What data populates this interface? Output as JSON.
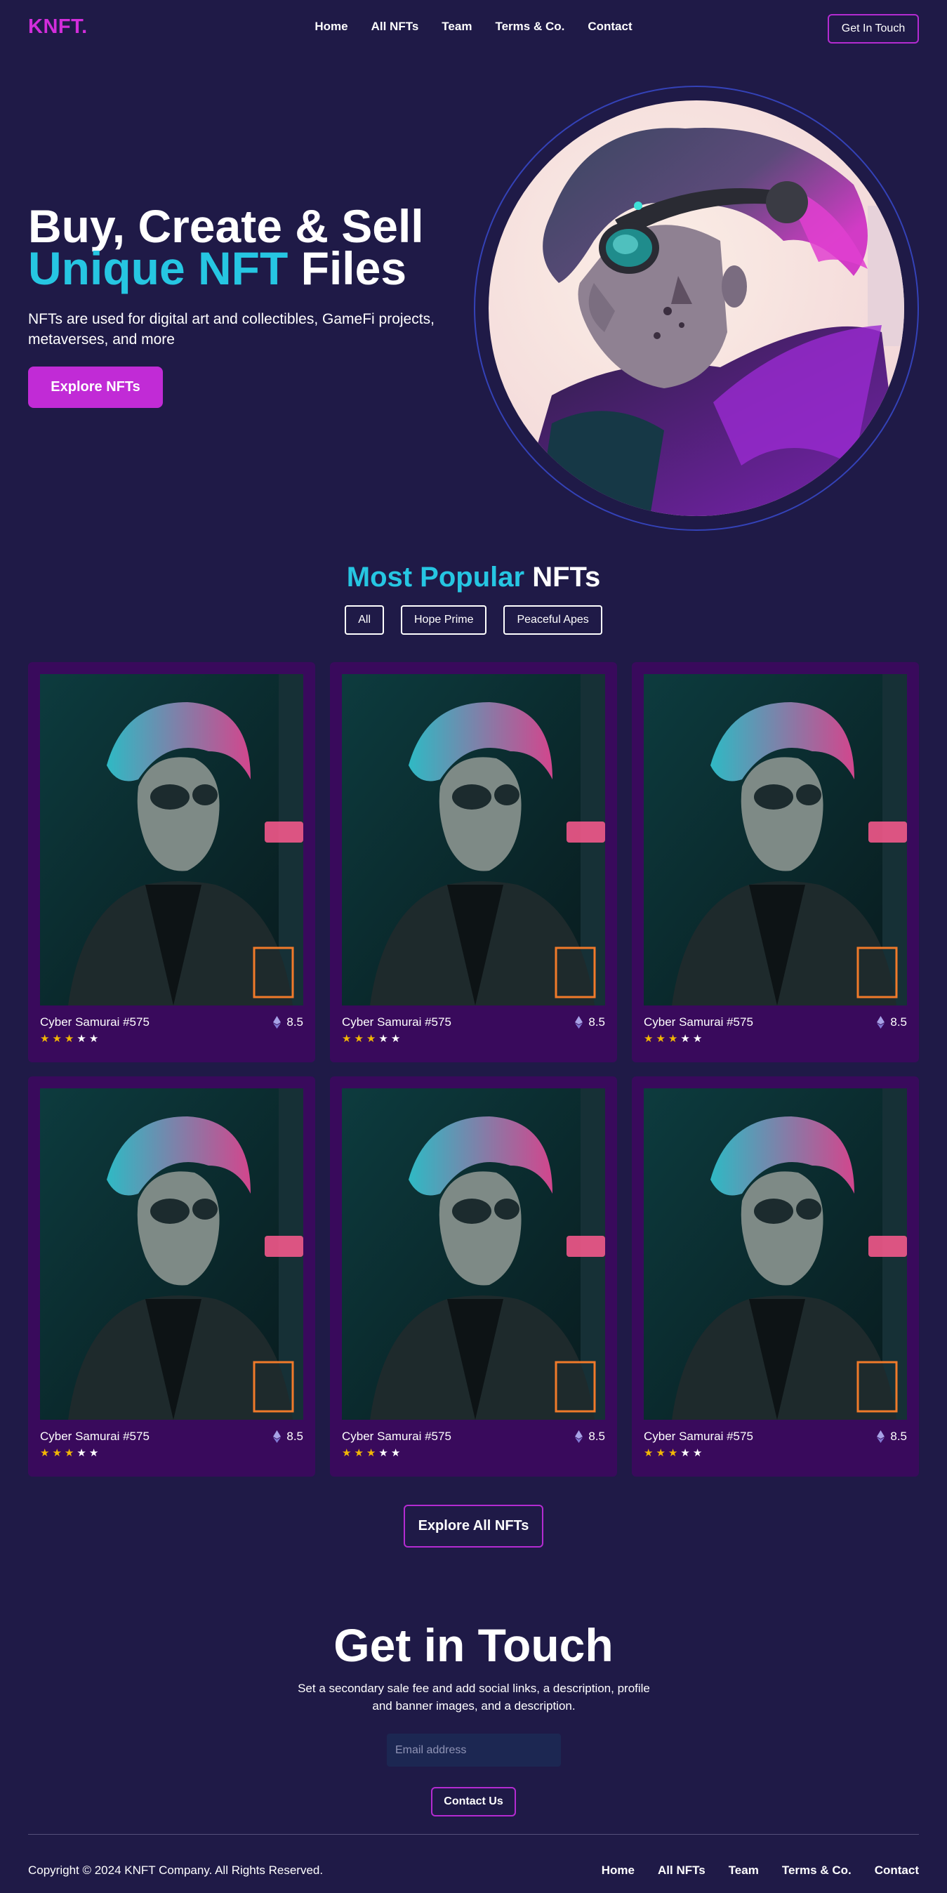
{
  "brand": {
    "logo": "KNFT.",
    "accent": "#d22ddb",
    "highlight": "#26c6e2",
    "background": "#1f1a47"
  },
  "nav": {
    "links": [
      "Home",
      "All NFTs",
      "Team",
      "Terms & Co.",
      "Contact"
    ],
    "cta": "Get In Touch"
  },
  "hero": {
    "title_line1": "Buy, Create & Sell",
    "title_accent": "Unique NFT",
    "title_rest": " Files",
    "subtitle": "NFTs are used for digital art and collectibles, GameFi projects, metaverses, and more",
    "cta": "Explore NFTs"
  },
  "popular": {
    "title_accent": "Most Popular",
    "title_rest": " NFTs",
    "filters": [
      "All",
      "Hope Prime",
      "Peaceful Apes"
    ],
    "cards": [
      {
        "name": "Cyber Samurai #575",
        "price": "8.5",
        "rating": 3,
        "max_rating": 5
      },
      {
        "name": "Cyber Samurai #575",
        "price": "8.5",
        "rating": 3,
        "max_rating": 5
      },
      {
        "name": "Cyber Samurai #575",
        "price": "8.5",
        "rating": 3,
        "max_rating": 5
      },
      {
        "name": "Cyber Samurai #575",
        "price": "8.5",
        "rating": 3,
        "max_rating": 5
      },
      {
        "name": "Cyber Samurai #575",
        "price": "8.5",
        "rating": 3,
        "max_rating": 5
      },
      {
        "name": "Cyber Samurai #575",
        "price": "8.5",
        "rating": 3,
        "max_rating": 5
      }
    ],
    "cta": "Explore All NFTs"
  },
  "contact": {
    "title": "Get in Touch",
    "subtitle": "Set a secondary sale fee and add social links, a description, profile and banner images, and a description.",
    "email_placeholder": "Email address",
    "cta": "Contact Us"
  },
  "footer": {
    "copyright": "Copyright © 2024 KNFT Company. All Rights Reserved.",
    "links": [
      "Home",
      "All NFTs",
      "Team",
      "Terms & Co.",
      "Contact"
    ]
  }
}
